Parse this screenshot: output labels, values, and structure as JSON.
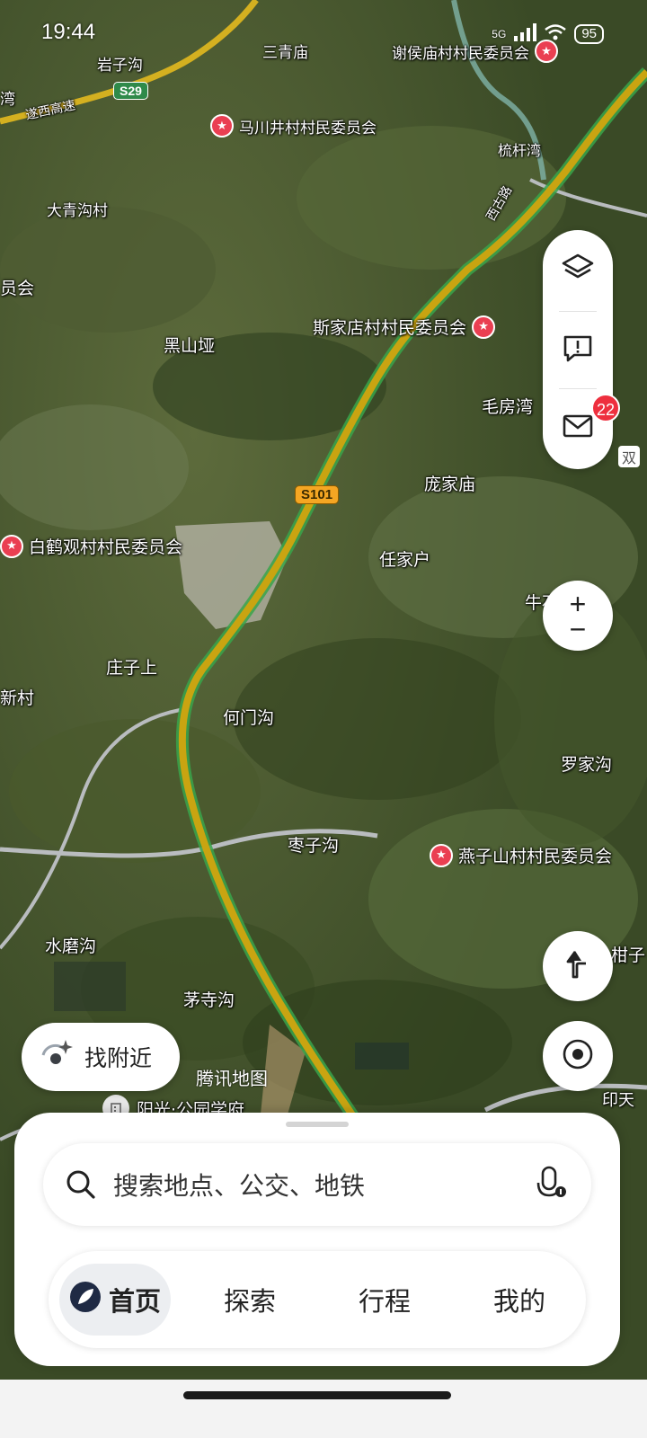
{
  "status_bar": {
    "time": "19:44",
    "network": "5G",
    "battery": "95"
  },
  "map": {
    "provider": "腾讯地图",
    "labels": [
      "岩子沟",
      "三青庙",
      "大青沟村",
      "黑山垭",
      "毛房湾",
      "庞家庙",
      "任家户",
      "牛石庙村",
      "庄子上",
      "何门沟",
      "罗家沟",
      "枣子沟",
      "水磨沟",
      "茅寺沟",
      "梳杆湾",
      "遂西高速",
      "西古路",
      "柑子",
      "印天",
      "湾",
      "员会",
      "新村",
      "双"
    ],
    "pois": [
      "谢侯庙村村民委员会",
      "马川井村村民委员会",
      "斯家店村村民委员会",
      "白鹤观村村民委员会",
      "燕子山村村民委员会"
    ],
    "road_shields": [
      "S29",
      "S101"
    ],
    "school": "阳光·公园学府"
  },
  "controls": {
    "layers": "layers-icon",
    "feedback": "feedback-icon",
    "messages": "mail-icon",
    "message_count": "22",
    "zoom_in": "+",
    "zoom_out": "−"
  },
  "nearby_button": {
    "label": "找附近"
  },
  "search": {
    "placeholder": "搜索地点、公交、地铁"
  },
  "tabs": [
    {
      "label": "首页",
      "active": true
    },
    {
      "label": "探索",
      "active": false
    },
    {
      "label": "行程",
      "active": false
    },
    {
      "label": "我的",
      "active": false
    }
  ],
  "colors": {
    "accent": "#1f3a8a",
    "poi_red": "#ea3f52",
    "highway_yellow": "#c9a411",
    "badge_red": "#ee2f3e"
  }
}
